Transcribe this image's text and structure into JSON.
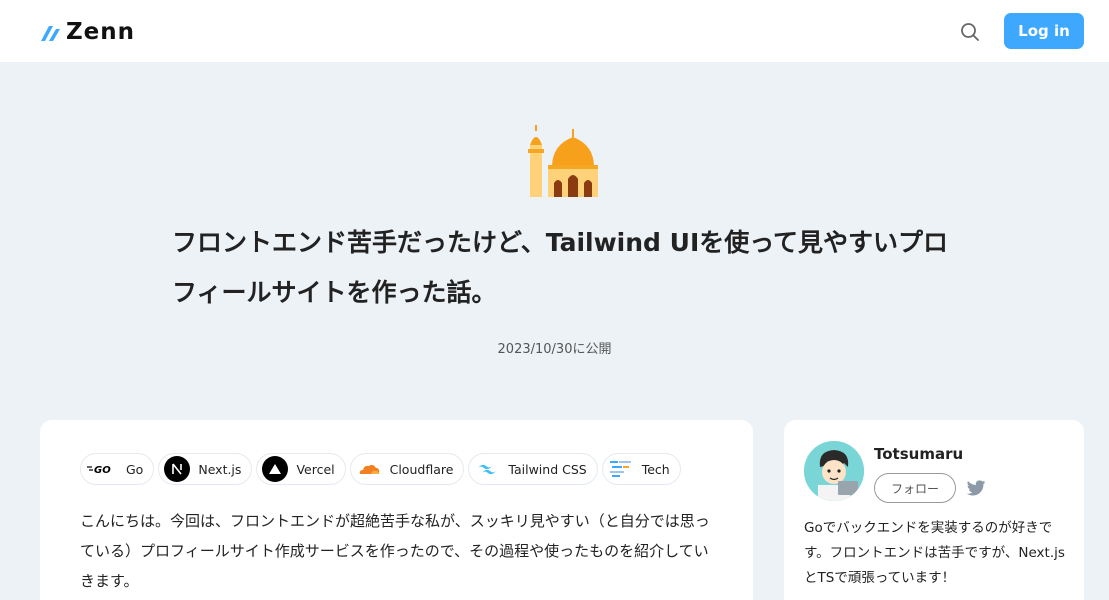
{
  "header": {
    "logo_text": "Zenn",
    "logo_icon": "zenn-logo-icon",
    "search_icon": "search-icon",
    "login_label": "Log in",
    "accent_color": "#3ea8ff"
  },
  "article": {
    "emoji": "mosque-emoji",
    "title": "フロントエンド苦手だったけど、Tailwind UIを使って見やすいプロフィールサイトを作った話。",
    "published": "2023/10/30に公開",
    "topics": [
      {
        "label": "Go",
        "icon": "go-icon"
      },
      {
        "label": "Next.js",
        "icon": "nextjs-icon"
      },
      {
        "label": "Vercel",
        "icon": "vercel-icon"
      },
      {
        "label": "Cloudflare",
        "icon": "cloudflare-icon"
      },
      {
        "label": "Tailwind CSS",
        "icon": "tailwind-icon"
      },
      {
        "label": "Tech",
        "icon": "tech-icon"
      }
    ],
    "body": "こんにちは。今回は、フロントエンドが超絶苦手な私が、スッキリ見やすい（と自分では思っている）プロフィールサイト作成サービスを作ったので、その過程や使ったものを紹介していきます。"
  },
  "author": {
    "name": "Totsumaru",
    "follow_label": "フォロー",
    "twitter_icon": "twitter-icon",
    "avatar": "avatar",
    "bio": "Goでバックエンドを実装するのが好きです。フロントエンドは苦手ですが、Next.jsとTSで頑張っています！"
  }
}
